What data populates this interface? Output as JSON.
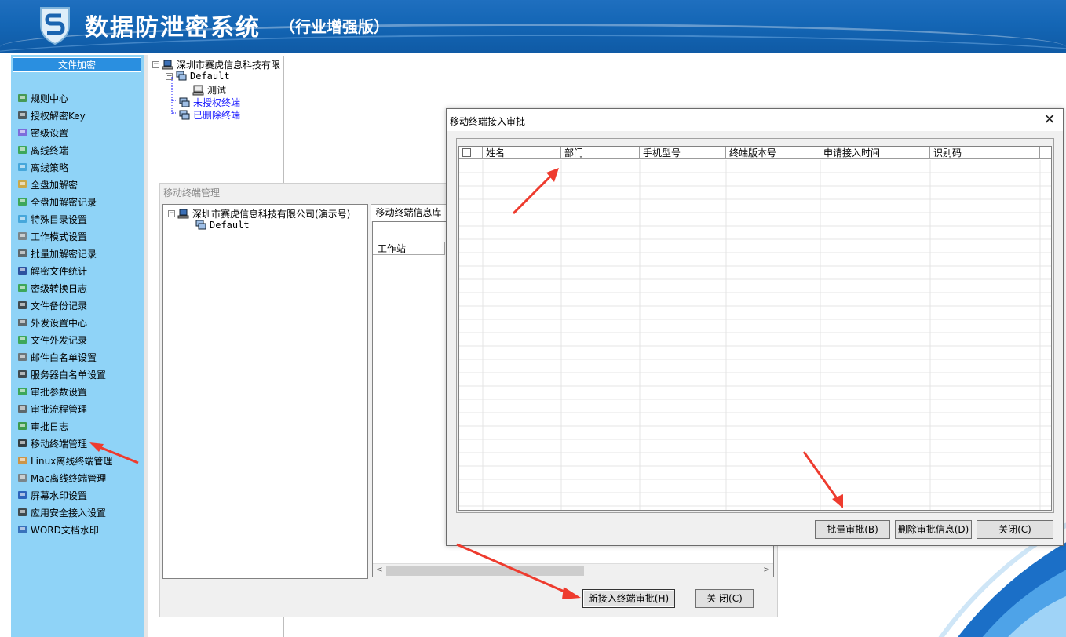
{
  "header": {
    "title": "数据防泄密系统",
    "edition": "（行业增强版）",
    "logo_icon": "shield-s-logo-icon"
  },
  "sidebar": {
    "header": "文件加密",
    "items": [
      {
        "label": "规则中心",
        "icon": "rules-center-icon"
      },
      {
        "label": "授权解密Key",
        "icon": "lock-key-icon"
      },
      {
        "label": "密级设置",
        "icon": "secret-level-icon"
      },
      {
        "label": "离线终端",
        "icon": "offline-check-icon"
      },
      {
        "label": "离线策略",
        "icon": "offline-policy-icon"
      },
      {
        "label": "全盘加解密",
        "icon": "full-disk-icon"
      },
      {
        "label": "全盘加解密记录",
        "icon": "full-disk-record-icon"
      },
      {
        "label": "特殊目录设置",
        "icon": "special-dir-icon"
      },
      {
        "label": "工作模式设置",
        "icon": "monitor-icon"
      },
      {
        "label": "批量加解密记录",
        "icon": "lock-icon"
      },
      {
        "label": "解密文件统计",
        "icon": "bar-chart-icon"
      },
      {
        "label": "密级转换日志",
        "icon": "log-convert-icon"
      },
      {
        "label": "文件备份记录",
        "icon": "backup-icon"
      },
      {
        "label": "外发设置中心",
        "icon": "gears-icon"
      },
      {
        "label": "文件外发记录",
        "icon": "outgoing-record-icon"
      },
      {
        "label": "邮件白名单设置",
        "icon": "mail-whitelist-icon"
      },
      {
        "label": "服务器白名单设置",
        "icon": "server-whitelist-icon"
      },
      {
        "label": "审批参数设置",
        "icon": "approval-params-icon"
      },
      {
        "label": "审批流程管理",
        "icon": "approval-flow-icon"
      },
      {
        "label": "审批日志",
        "icon": "approval-log-icon"
      },
      {
        "label": "移动终端管理",
        "icon": "mobile-phone-icon"
      },
      {
        "label": "Linux离线终端管理",
        "icon": "linux-icon"
      },
      {
        "label": "Mac离线终端管理",
        "icon": "mac-icon"
      },
      {
        "label": "屏幕水印设置",
        "icon": "screen-watermark-icon"
      },
      {
        "label": "应用安全接入设置",
        "icon": "app-secure-access-icon"
      },
      {
        "label": "WORD文档水印",
        "icon": "word-watermark-icon"
      }
    ]
  },
  "tree": {
    "root": "深圳市赛虎信息科技有限",
    "default": "Default",
    "child": "测试",
    "unauthorized": "未授权终端",
    "deleted": "已删除终端"
  },
  "mobile_mgmt": {
    "title": "移动终端管理",
    "tree_root": "深圳市赛虎信息科技有限公司(演示号)",
    "tree_default": "Default",
    "tab": "移动终端信息库",
    "col_workstation": "工作站",
    "btn_new_approval": "新接入终端审批(H)",
    "btn_close": "关  闭(C)"
  },
  "approval_dialog": {
    "title": "移动终端接入审批",
    "columns": [
      "姓名",
      "部门",
      "手机型号",
      "终端版本号",
      "申请接入时间",
      "识别码"
    ],
    "btn_batch": "批量审批(B)",
    "btn_delete": "删除审批信息(D)",
    "btn_close": "关闭(C)"
  },
  "colors": {
    "header_blue": "#1466b5",
    "sidebar_bg": "#8fd3f7",
    "sidebar_header": "#2a8fe0",
    "link_blue": "#1a1aff",
    "arrow_red": "#ee3b2e"
  }
}
